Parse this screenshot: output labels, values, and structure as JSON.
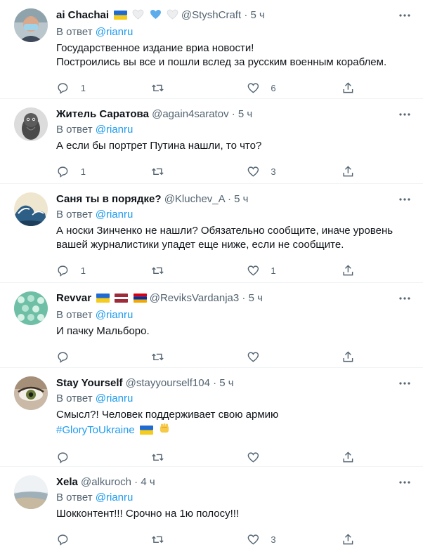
{
  "reply_prefix": "В ответ",
  "mention": "@rianru",
  "tweets": [
    {
      "name": "ai Chachai",
      "flags": [
        "flag-ua",
        "heart-white",
        "heart-blue",
        "heart-white"
      ],
      "handle": "@StyshCraft",
      "sep": "·",
      "time": "5 ч",
      "text": "Государственное издание вриа новости!\nПостроились вы все и пошли вслед за русским военным кораблем.",
      "replies": "1",
      "retweets": "",
      "likes": "6"
    },
    {
      "name": "Житель Саратова",
      "flags": [],
      "handle": "@again4saratov",
      "sep": "·",
      "time": "5 ч",
      "text": "А если бы портрет Путина нашли, то что?",
      "replies": "1",
      "retweets": "",
      "likes": "3"
    },
    {
      "name": "Саня ты в порядке?",
      "flags": [],
      "handle": "@Kluchev_A",
      "sep": "·",
      "time": "5 ч",
      "text": "А носки Зинченко не нашли? Обязательно сообщите, иначе уровень вашей журналистики упадет еще ниже, если не сообщите.",
      "replies": "1",
      "retweets": "",
      "likes": "1"
    },
    {
      "name": "Revvar",
      "flags": [
        "flag-ua",
        "flag-lv",
        "flag-am"
      ],
      "handle": "@ReviksVardanja3",
      "sep": "·",
      "time": "5 ч",
      "text": "И пачку Мальборо.",
      "replies": "",
      "retweets": "",
      "likes": ""
    },
    {
      "name": "Stay Yourself",
      "flags": [],
      "handle": "@stayyourself104",
      "sep": "·",
      "time": "5 ч",
      "text": "Смысл?! Человек поддерживает свою армию",
      "hashtag": "#GloryToUkraine",
      "replies": "",
      "retweets": "",
      "likes": ""
    },
    {
      "name": "Xela",
      "flags": [],
      "handle": "@alkuroch",
      "sep": "·",
      "time": "4 ч",
      "text": "Шокконтент!!! Срочно на 1ю полосу!!!",
      "replies": "",
      "retweets": "",
      "likes": "3"
    }
  ],
  "colors": {
    "accent": "#1d9bf0",
    "secondary_text": "#536471",
    "border": "#eff3f4"
  }
}
